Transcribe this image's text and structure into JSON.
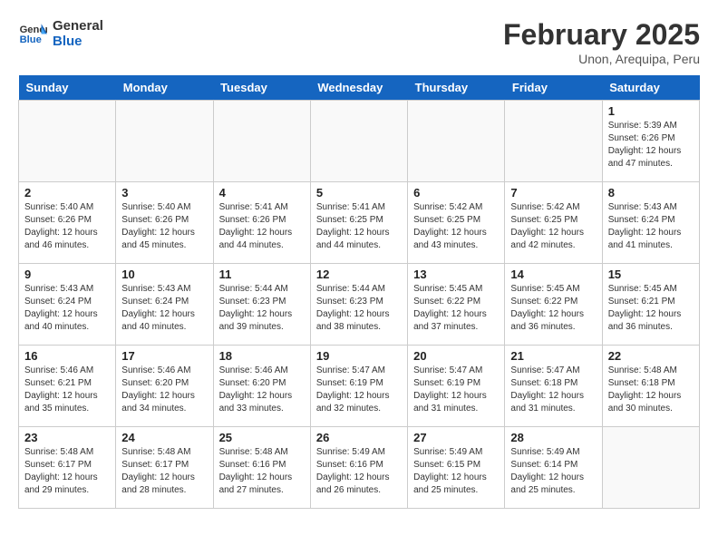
{
  "header": {
    "logo_line1": "General",
    "logo_line2": "Blue",
    "month": "February 2025",
    "location": "Unon, Arequipa, Peru"
  },
  "weekdays": [
    "Sunday",
    "Monday",
    "Tuesday",
    "Wednesday",
    "Thursday",
    "Friday",
    "Saturday"
  ],
  "weeks": [
    [
      {
        "day": "",
        "info": ""
      },
      {
        "day": "",
        "info": ""
      },
      {
        "day": "",
        "info": ""
      },
      {
        "day": "",
        "info": ""
      },
      {
        "day": "",
        "info": ""
      },
      {
        "day": "",
        "info": ""
      },
      {
        "day": "1",
        "info": "Sunrise: 5:39 AM\nSunset: 6:26 PM\nDaylight: 12 hours\nand 47 minutes."
      }
    ],
    [
      {
        "day": "2",
        "info": "Sunrise: 5:40 AM\nSunset: 6:26 PM\nDaylight: 12 hours\nand 46 minutes."
      },
      {
        "day": "3",
        "info": "Sunrise: 5:40 AM\nSunset: 6:26 PM\nDaylight: 12 hours\nand 45 minutes."
      },
      {
        "day": "4",
        "info": "Sunrise: 5:41 AM\nSunset: 6:26 PM\nDaylight: 12 hours\nand 44 minutes."
      },
      {
        "day": "5",
        "info": "Sunrise: 5:41 AM\nSunset: 6:25 PM\nDaylight: 12 hours\nand 44 minutes."
      },
      {
        "day": "6",
        "info": "Sunrise: 5:42 AM\nSunset: 6:25 PM\nDaylight: 12 hours\nand 43 minutes."
      },
      {
        "day": "7",
        "info": "Sunrise: 5:42 AM\nSunset: 6:25 PM\nDaylight: 12 hours\nand 42 minutes."
      },
      {
        "day": "8",
        "info": "Sunrise: 5:43 AM\nSunset: 6:24 PM\nDaylight: 12 hours\nand 41 minutes."
      }
    ],
    [
      {
        "day": "9",
        "info": "Sunrise: 5:43 AM\nSunset: 6:24 PM\nDaylight: 12 hours\nand 40 minutes."
      },
      {
        "day": "10",
        "info": "Sunrise: 5:43 AM\nSunset: 6:24 PM\nDaylight: 12 hours\nand 40 minutes."
      },
      {
        "day": "11",
        "info": "Sunrise: 5:44 AM\nSunset: 6:23 PM\nDaylight: 12 hours\nand 39 minutes."
      },
      {
        "day": "12",
        "info": "Sunrise: 5:44 AM\nSunset: 6:23 PM\nDaylight: 12 hours\nand 38 minutes."
      },
      {
        "day": "13",
        "info": "Sunrise: 5:45 AM\nSunset: 6:22 PM\nDaylight: 12 hours\nand 37 minutes."
      },
      {
        "day": "14",
        "info": "Sunrise: 5:45 AM\nSunset: 6:22 PM\nDaylight: 12 hours\nand 36 minutes."
      },
      {
        "day": "15",
        "info": "Sunrise: 5:45 AM\nSunset: 6:21 PM\nDaylight: 12 hours\nand 36 minutes."
      }
    ],
    [
      {
        "day": "16",
        "info": "Sunrise: 5:46 AM\nSunset: 6:21 PM\nDaylight: 12 hours\nand 35 minutes."
      },
      {
        "day": "17",
        "info": "Sunrise: 5:46 AM\nSunset: 6:20 PM\nDaylight: 12 hours\nand 34 minutes."
      },
      {
        "day": "18",
        "info": "Sunrise: 5:46 AM\nSunset: 6:20 PM\nDaylight: 12 hours\nand 33 minutes."
      },
      {
        "day": "19",
        "info": "Sunrise: 5:47 AM\nSunset: 6:19 PM\nDaylight: 12 hours\nand 32 minutes."
      },
      {
        "day": "20",
        "info": "Sunrise: 5:47 AM\nSunset: 6:19 PM\nDaylight: 12 hours\nand 31 minutes."
      },
      {
        "day": "21",
        "info": "Sunrise: 5:47 AM\nSunset: 6:18 PM\nDaylight: 12 hours\nand 31 minutes."
      },
      {
        "day": "22",
        "info": "Sunrise: 5:48 AM\nSunset: 6:18 PM\nDaylight: 12 hours\nand 30 minutes."
      }
    ],
    [
      {
        "day": "23",
        "info": "Sunrise: 5:48 AM\nSunset: 6:17 PM\nDaylight: 12 hours\nand 29 minutes."
      },
      {
        "day": "24",
        "info": "Sunrise: 5:48 AM\nSunset: 6:17 PM\nDaylight: 12 hours\nand 28 minutes."
      },
      {
        "day": "25",
        "info": "Sunrise: 5:48 AM\nSunset: 6:16 PM\nDaylight: 12 hours\nand 27 minutes."
      },
      {
        "day": "26",
        "info": "Sunrise: 5:49 AM\nSunset: 6:16 PM\nDaylight: 12 hours\nand 26 minutes."
      },
      {
        "day": "27",
        "info": "Sunrise: 5:49 AM\nSunset: 6:15 PM\nDaylight: 12 hours\nand 25 minutes."
      },
      {
        "day": "28",
        "info": "Sunrise: 5:49 AM\nSunset: 6:14 PM\nDaylight: 12 hours\nand 25 minutes."
      },
      {
        "day": "",
        "info": ""
      }
    ]
  ]
}
